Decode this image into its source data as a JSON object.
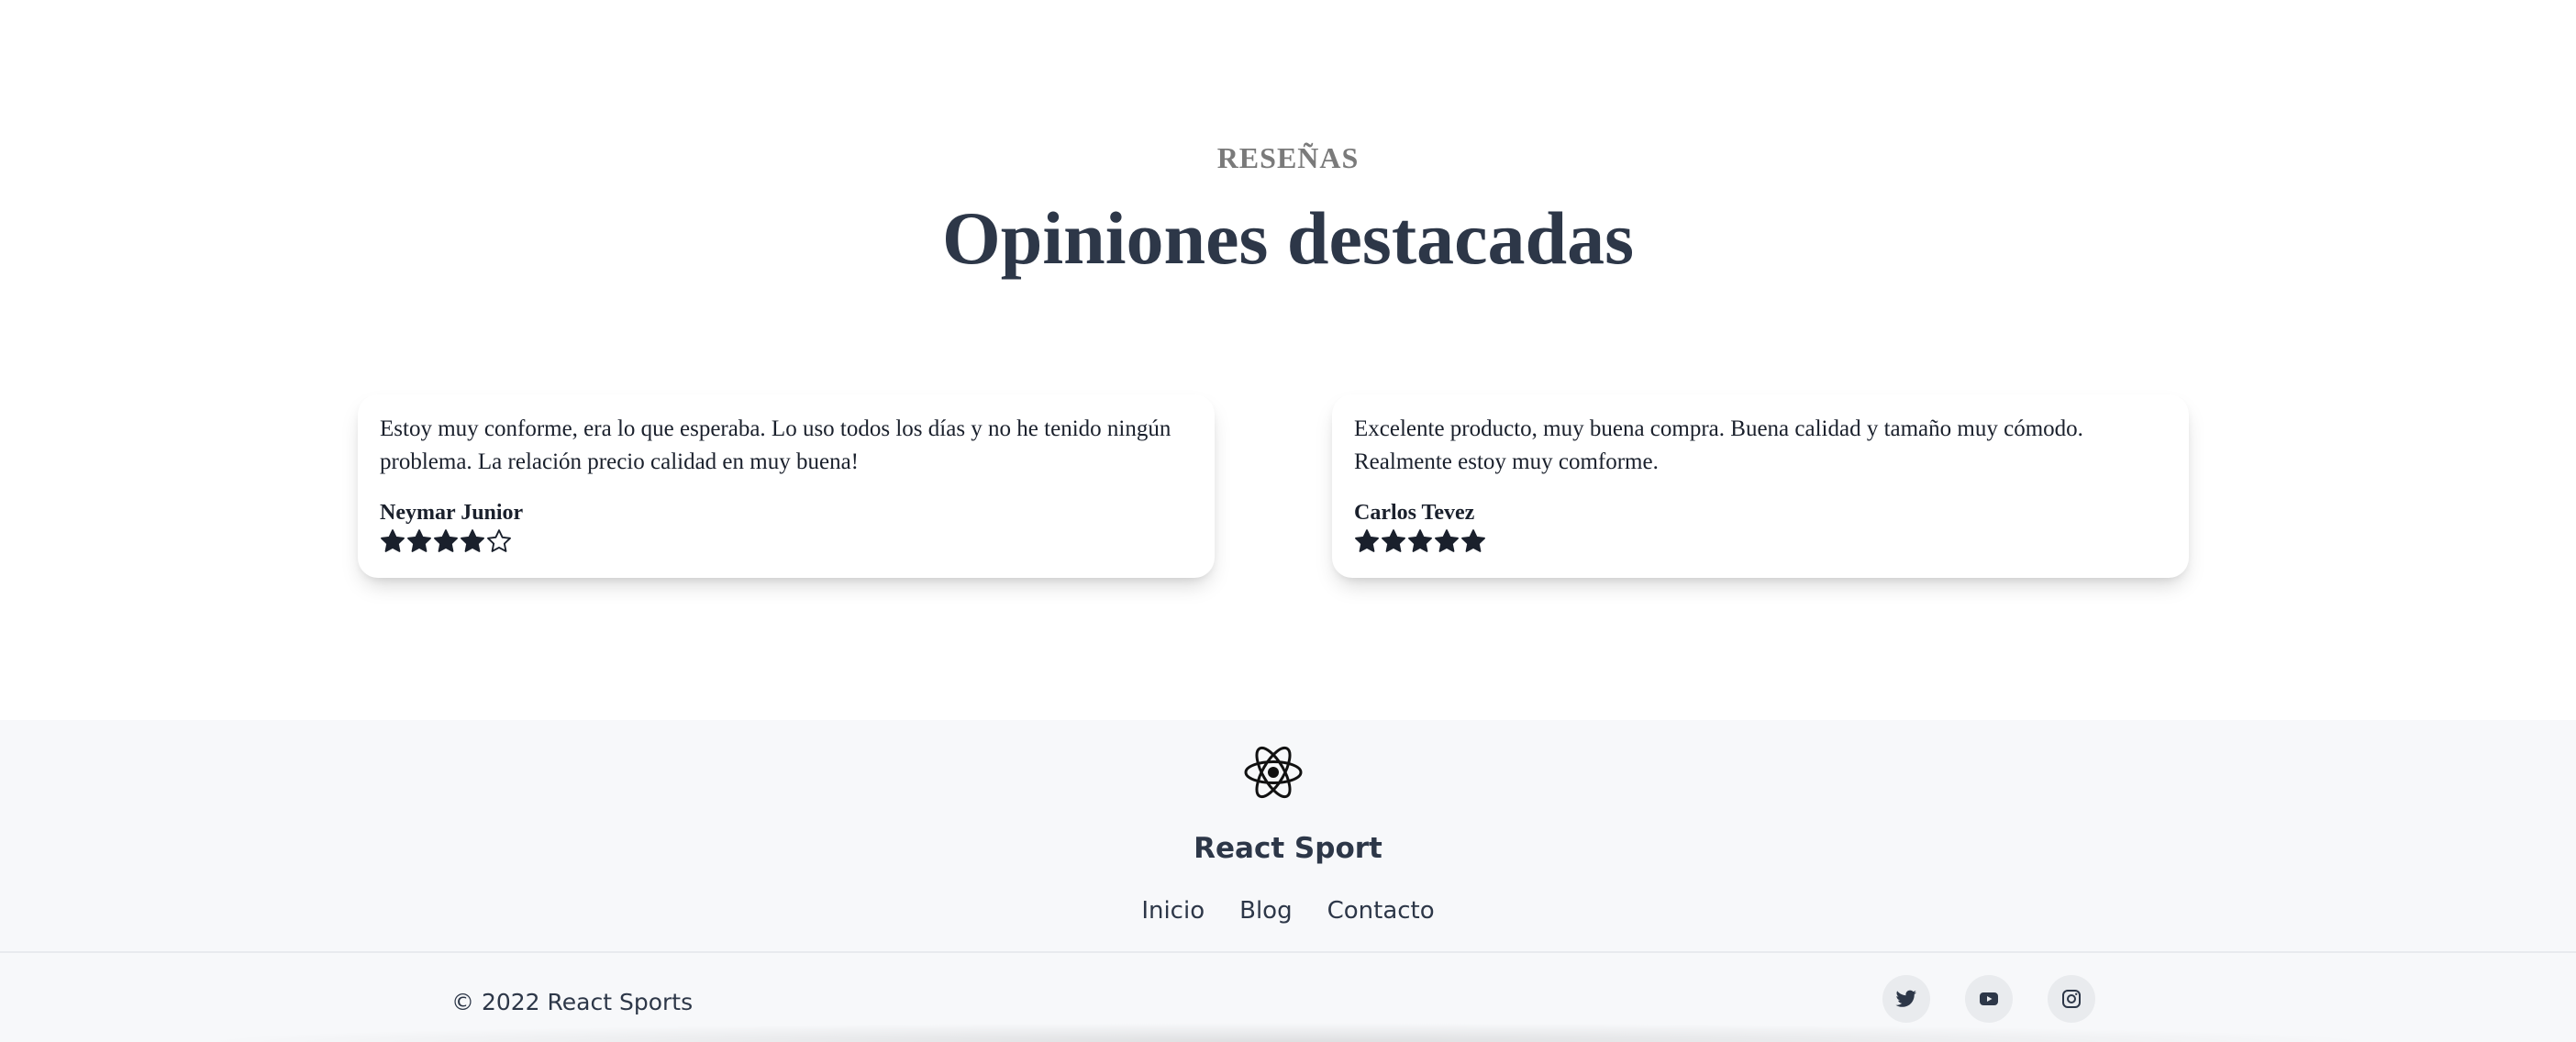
{
  "reviews": {
    "eyebrow": "RESEÑAS",
    "title": "Opiniones destacadas",
    "items": [
      {
        "text": "Estoy muy conforme, era lo que esperaba. Lo uso todos los días y no he tenido ningún problema. La relación precio calidad en muy buena!",
        "author": "Neymar Junior",
        "rating": 4,
        "max_rating": 5
      },
      {
        "text": "Excelente producto, muy buena compra. Buena calidad y tamaño muy cómodo. Realmente estoy muy comforme.",
        "author": "Carlos Tevez",
        "rating": 5,
        "max_rating": 5
      }
    ]
  },
  "footer": {
    "logo_icon": "react-atom-icon",
    "brand": "React Sport",
    "nav": [
      {
        "label": "Inicio"
      },
      {
        "label": "Blog"
      },
      {
        "label": "Contacto"
      }
    ],
    "copyright": "© 2022 React Sports",
    "social": [
      {
        "icon": "twitter-icon"
      },
      {
        "icon": "youtube-icon"
      },
      {
        "icon": "instagram-icon"
      }
    ]
  },
  "colors": {
    "heading": "#2d3748",
    "eyebrow": "#7a7a7a",
    "text": "#1a202c",
    "footer_bg": "#f7f8fa",
    "social_bg": "#e9ebee"
  }
}
